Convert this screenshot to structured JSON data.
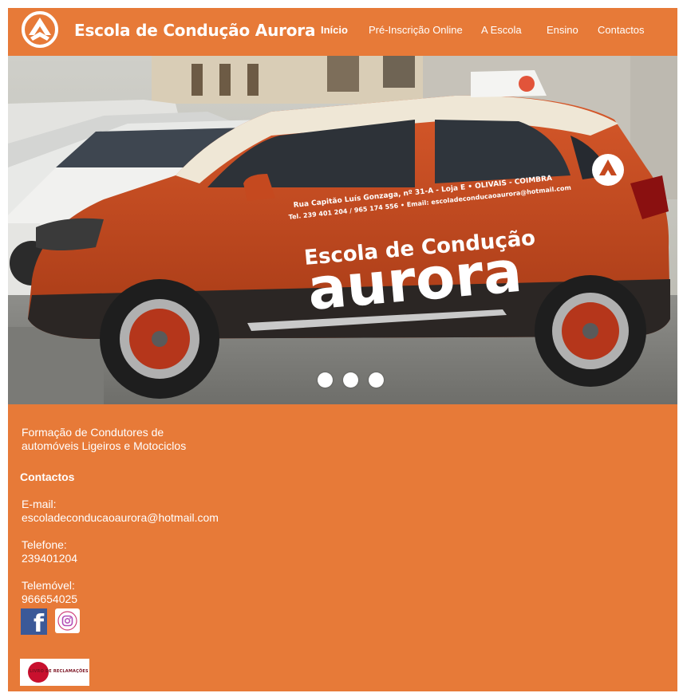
{
  "brand": {
    "name": "Escola de Condução Aurora"
  },
  "nav": {
    "items": [
      {
        "label": "Início",
        "active": true
      },
      {
        "label": "Pré-Inscrição Online",
        "active": false
      },
      {
        "label": "A Escola",
        "active": false
      },
      {
        "label": "Ensino",
        "active": false
      },
      {
        "label": "Contactos",
        "active": false
      }
    ]
  },
  "hero": {
    "car_decal": {
      "address": "Rua Capitão Luís Gonzaga, nº 31-A - Loja E • OLIVAIS - COIMBRA",
      "phones_email": "Tel. 239 401 204 / 965 174 556 • Email: escoladeconducaoaurora@hotmail.com",
      "school_line": "Escola de Condução",
      "school_name": "aurora"
    },
    "carousel": {
      "slides": 3,
      "active_index": 0
    }
  },
  "footer": {
    "tagline": "Formação de Condutores de automóveis Ligeiros e Motociclos",
    "contacts_title": "Contactos",
    "email_label": "E-mail:",
    "email_value": "escoladeconducaoaurora@hotmail.com",
    "phone_label": "Telefone:",
    "phone_value": "239401204",
    "mobile_label": "Telemóvel:",
    "mobile_value": "966654025",
    "social": [
      "facebook-icon",
      "instagram-icon"
    ],
    "complaints_book": "LIVRO DE RECLAMAÇÕES"
  },
  "colors": {
    "accent": "#e77a38",
    "car_body": "#c5491f",
    "car_roof": "#efe7d6",
    "facebook": "#3b5998",
    "complaints_red": "#c8102e"
  }
}
